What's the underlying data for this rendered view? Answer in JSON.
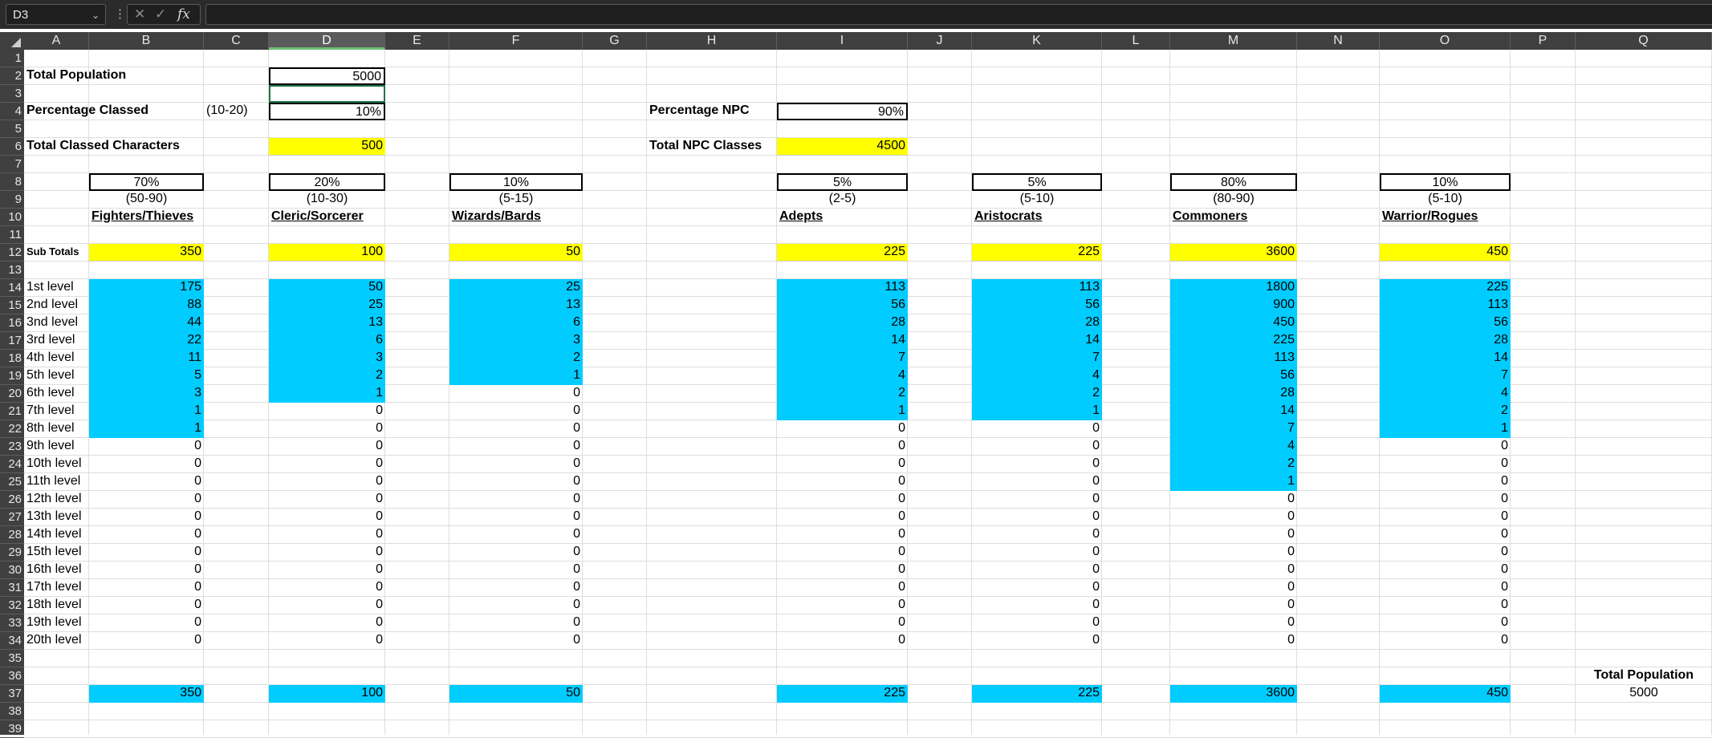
{
  "app": {
    "name_box": "D3",
    "formula_value": "",
    "fx_label": "fx",
    "cancel_glyph": "✕",
    "enter_glyph": "✓",
    "menu_glyph": "⋮",
    "chevron_glyph": "⌄"
  },
  "columns": [
    "A",
    "B",
    "C",
    "D",
    "E",
    "F",
    "G",
    "H",
    "I",
    "J",
    "K",
    "L",
    "M",
    "N",
    "O",
    "P",
    "Q"
  ],
  "active_column": "D",
  "rows": [
    1,
    2,
    3,
    4,
    5,
    6,
    7,
    8,
    9,
    10,
    11,
    12,
    13,
    14,
    15,
    16,
    17,
    18,
    19,
    20,
    21,
    22,
    23,
    24,
    25,
    26,
    27,
    28,
    29,
    30,
    31,
    32,
    33,
    34,
    35,
    36,
    37,
    38,
    39
  ],
  "setup": {
    "total_population_label": "Total Population",
    "total_population_value": "5000",
    "percentage_classed_label": "Percentage Classed",
    "percentage_classed_range": "(10-20)",
    "percentage_classed_value": "10%",
    "total_classed_label": "Total Classed Characters",
    "total_classed_value": "500",
    "percentage_npc_label": "Percentage NPC",
    "percentage_npc_value": "90%",
    "total_npc_label": "Total NPC Classes",
    "total_npc_value": "4500",
    "sub_totals_label": "Sub Totals"
  },
  "levels": [
    "1st level",
    "2nd level",
    "3nd level",
    "3rd level",
    "4th level",
    "5th level",
    "6th level",
    "7th level",
    "8th level",
    "9th level",
    "10th level",
    "11th level",
    "12th level",
    "13th level",
    "14th level",
    "15th level",
    "16th level",
    "17th level",
    "18th level",
    "19th level",
    "20th level"
  ],
  "classes": [
    {
      "name": "Fighters/Thieves",
      "percent": "70%",
      "range": "(50-90)",
      "subtotal": "350",
      "total": "350",
      "values": [
        "175",
        "88",
        "44",
        "22",
        "11",
        "5",
        "3",
        "1",
        "1",
        "0",
        "0",
        "0",
        "0",
        "0",
        "0",
        "0",
        "0",
        "0",
        "0",
        "0",
        "0"
      ],
      "blue_rows": 9
    },
    {
      "name": "Cleric/Sorcerer",
      "percent": "20%",
      "range": "(10-30)",
      "subtotal": "100",
      "total": "100",
      "values": [
        "50",
        "25",
        "13",
        "6",
        "3",
        "2",
        "1",
        "0",
        "0",
        "0",
        "0",
        "0",
        "0",
        "0",
        "0",
        "0",
        "0",
        "0",
        "0",
        "0",
        "0"
      ],
      "blue_rows": 7
    },
    {
      "name": "Wizards/Bards",
      "percent": "10%",
      "range": "(5-15)",
      "subtotal": "50",
      "total": "50",
      "values": [
        "25",
        "13",
        "6",
        "3",
        "2",
        "1",
        "0",
        "0",
        "0",
        "0",
        "0",
        "0",
        "0",
        "0",
        "0",
        "0",
        "0",
        "0",
        "0",
        "0",
        "0"
      ],
      "blue_rows": 6
    },
    {
      "name": "Adepts",
      "percent": "5%",
      "range": "(2-5)",
      "subtotal": "225",
      "total": "225",
      "values": [
        "113",
        "56",
        "28",
        "14",
        "7",
        "4",
        "2",
        "1",
        "0",
        "0",
        "0",
        "0",
        "0",
        "0",
        "0",
        "0",
        "0",
        "0",
        "0",
        "0",
        "0"
      ],
      "blue_rows": 8
    },
    {
      "name": "Aristocrats",
      "percent": "5%",
      "range": "(5-10)",
      "subtotal": "225",
      "total": "225",
      "values": [
        "113",
        "56",
        "28",
        "14",
        "7",
        "4",
        "2",
        "1",
        "0",
        "0",
        "0",
        "0",
        "0",
        "0",
        "0",
        "0",
        "0",
        "0",
        "0",
        "0",
        "0"
      ],
      "blue_rows": 8
    },
    {
      "name": "Commoners",
      "percent": "80%",
      "range": "(80-90)",
      "subtotal": "3600",
      "total": "3600",
      "values": [
        "1800",
        "900",
        "450",
        "225",
        "113",
        "56",
        "28",
        "14",
        "7",
        "4",
        "2",
        "1",
        "0",
        "0",
        "0",
        "0",
        "0",
        "0",
        "0",
        "0",
        "0"
      ],
      "blue_rows": 12
    },
    {
      "name": "Warrior/Rogues",
      "percent": "10%",
      "range": "(5-10)",
      "subtotal": "450",
      "total": "450",
      "values": [
        "225",
        "113",
        "56",
        "28",
        "14",
        "7",
        "4",
        "2",
        "1",
        "0",
        "0",
        "0",
        "0",
        "0",
        "0",
        "0",
        "0",
        "0",
        "0",
        "0",
        "0"
      ],
      "blue_rows": 9
    }
  ],
  "grand_total": {
    "label": "Total Population",
    "value": "5000"
  },
  "colors": {
    "yellow": "#ffff00",
    "blue": "#00ccff",
    "header": "#404040"
  }
}
